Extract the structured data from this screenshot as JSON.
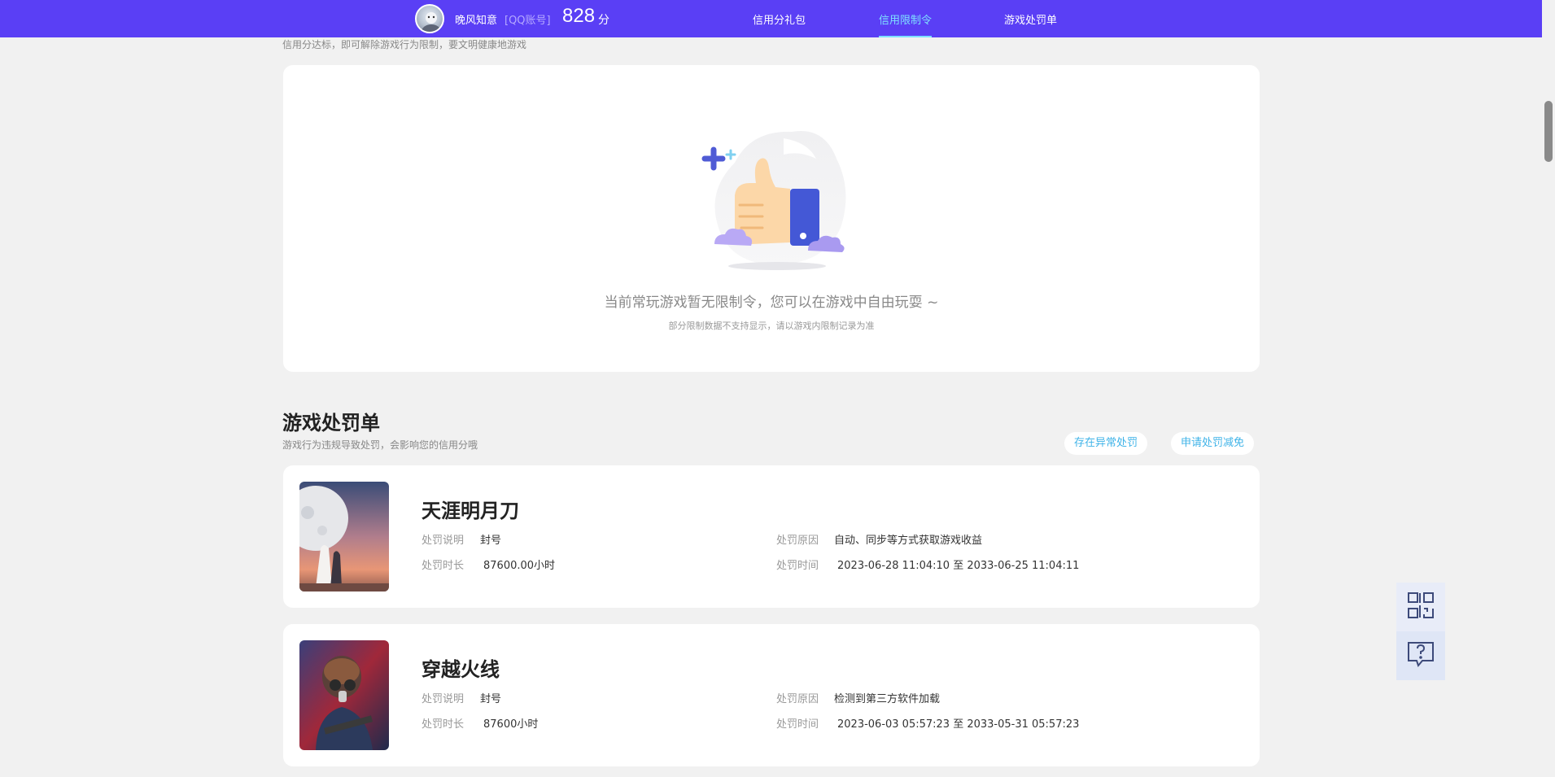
{
  "header": {
    "username": "晚风知意",
    "account_type": "[QQ账号]",
    "score": "828",
    "score_unit": "分",
    "tabs": [
      {
        "label": "信用分礼包",
        "active": false
      },
      {
        "label": "信用限制令",
        "active": true
      },
      {
        "label": "游戏处罚单",
        "active": false
      }
    ],
    "bar_color": "#5a3ff5",
    "active_tab_color": "#7ee0ff"
  },
  "limit_section": {
    "subtitle": "信用分达标，即可解除游戏行为限制，要文明健康地游戏",
    "empty_title": "当前常玩游戏暂无限制令，您可以在游戏中自由玩耍 ~",
    "empty_sub": "部分限制数据不支持显示，请以游戏内限制记录为准",
    "illustration_icon": "thumbs-up-illustration"
  },
  "penalty_section": {
    "title": "游戏处罚单",
    "desc": "游戏行为违规导致处罚，会影响您的信用分哦",
    "buttons": {
      "anomaly": "存在异常处罚",
      "reduce": "申请处罚减免"
    },
    "items": [
      {
        "game": "天涯明月刀",
        "label_desc": "处罚说明",
        "value_desc": "封号",
        "label_duration": "处罚时长",
        "value_duration": "87600.00小时",
        "label_reason": "处罚原因",
        "value_reason": "自动、同步等方式获取游戏收益",
        "label_time": "处罚时间",
        "value_time": "2023-06-28 11:04:10 至 2033-06-25 11:04:11"
      },
      {
        "game": "穿越火线",
        "label_desc": "处罚说明",
        "value_desc": "封号",
        "label_duration": "处罚时长",
        "value_duration": "87600小时",
        "label_reason": "处罚原因",
        "value_reason": "检测到第三方软件加载",
        "label_time": "处罚时间",
        "value_time": "2023-06-03 05:57:23 至 2033-05-31 05:57:23"
      }
    ]
  },
  "floating": {
    "qr_icon": "qr-code-icon",
    "help_icon": "help-chat-icon"
  }
}
